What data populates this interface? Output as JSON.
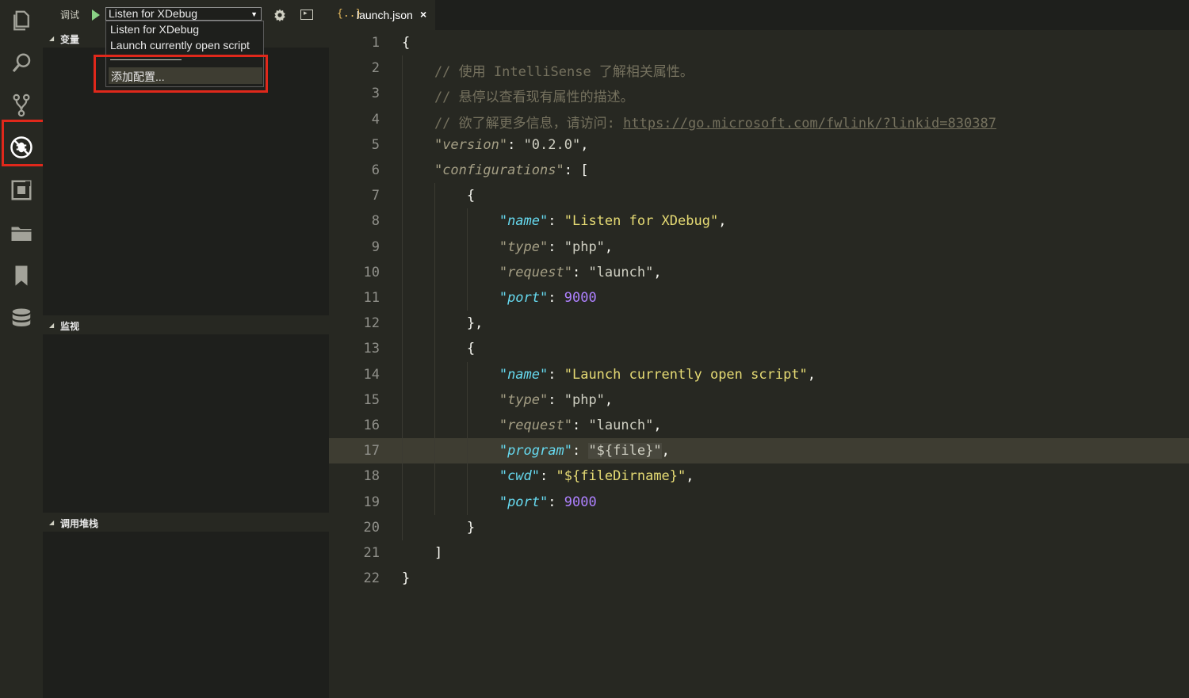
{
  "activity_bar": {
    "icons": [
      "explorer-icon",
      "search-icon",
      "source-control-icon",
      "debug-icon",
      "extensions-icon",
      "folder-icon",
      "bookmark-icon",
      "database-icon"
    ]
  },
  "debug": {
    "title": "调试",
    "selected_config": "Listen for XDebug",
    "options": [
      "Listen for XDebug",
      "Launch currently open script"
    ],
    "add_config": "添加配置..."
  },
  "sections": {
    "variables": "变量",
    "watch": "监视",
    "call_stack": "调用堆栈"
  },
  "editor": {
    "tab_icon": "{..}",
    "tab_label": "launch.json",
    "tab_close": "×",
    "current_line": 17,
    "lines": [
      [
        [
          "{",
          "punc"
        ]
      ],
      [
        [
          "    // 使用 IntelliSense 了解相关属性。",
          "com"
        ]
      ],
      [
        [
          "    // 悬停以查看现有属性的描述。",
          "com"
        ]
      ],
      [
        [
          "    // 欲了解更多信息，请访问: ",
          "com"
        ],
        [
          "https://go.microsoft.com/fwlink/?linkid=830387",
          "link"
        ]
      ],
      [
        [
          "    ",
          "punc"
        ],
        [
          "\"version\"",
          "keydim"
        ],
        [
          ": ",
          "punc"
        ],
        [
          "\"0.2.0\"",
          "strdim"
        ],
        [
          ",",
          "punc"
        ]
      ],
      [
        [
          "    ",
          "punc"
        ],
        [
          "\"configurations\"",
          "keydim"
        ],
        [
          ": [",
          "punc"
        ]
      ],
      [
        [
          "        {",
          "punc"
        ]
      ],
      [
        [
          "            ",
          "punc"
        ],
        [
          "\"name\"",
          "key"
        ],
        [
          ": ",
          "punc"
        ],
        [
          "\"Listen for XDebug\"",
          "str"
        ],
        [
          ",",
          "punc"
        ]
      ],
      [
        [
          "            ",
          "punc"
        ],
        [
          "\"type\"",
          "keydim"
        ],
        [
          ": ",
          "punc"
        ],
        [
          "\"php\"",
          "strdim"
        ],
        [
          ",",
          "punc"
        ]
      ],
      [
        [
          "            ",
          "punc"
        ],
        [
          "\"request\"",
          "keydim"
        ],
        [
          ": ",
          "punc"
        ],
        [
          "\"launch\"",
          "strdim"
        ],
        [
          ",",
          "punc"
        ]
      ],
      [
        [
          "            ",
          "punc"
        ],
        [
          "\"port\"",
          "key"
        ],
        [
          ": ",
          "punc"
        ],
        [
          "9000",
          "num"
        ]
      ],
      [
        [
          "        },",
          "punc"
        ]
      ],
      [
        [
          "        {",
          "punc"
        ]
      ],
      [
        [
          "            ",
          "punc"
        ],
        [
          "\"name\"",
          "key"
        ],
        [
          ": ",
          "punc"
        ],
        [
          "\"Launch currently open script\"",
          "str"
        ],
        [
          ",",
          "punc"
        ]
      ],
      [
        [
          "            ",
          "punc"
        ],
        [
          "\"type\"",
          "keydim"
        ],
        [
          ": ",
          "punc"
        ],
        [
          "\"php\"",
          "strdim"
        ],
        [
          ",",
          "punc"
        ]
      ],
      [
        [
          "            ",
          "punc"
        ],
        [
          "\"request\"",
          "keydim"
        ],
        [
          ": ",
          "punc"
        ],
        [
          "\"launch\"",
          "strdim"
        ],
        [
          ",",
          "punc"
        ]
      ],
      [
        [
          "            ",
          "punc"
        ],
        [
          "\"program\"",
          "key"
        ],
        [
          ": ",
          "punc"
        ],
        [
          "\"${file}\"",
          "strsel"
        ],
        [
          ",",
          "punc"
        ]
      ],
      [
        [
          "            ",
          "punc"
        ],
        [
          "\"cwd\"",
          "key"
        ],
        [
          ": ",
          "punc"
        ],
        [
          "\"${fileDirname}\"",
          "str"
        ],
        [
          ",",
          "punc"
        ]
      ],
      [
        [
          "            ",
          "punc"
        ],
        [
          "\"port\"",
          "key"
        ],
        [
          ": ",
          "punc"
        ],
        [
          "9000",
          "num"
        ]
      ],
      [
        [
          "        }",
          "punc"
        ]
      ],
      [
        [
          "    ]",
          "punc"
        ]
      ],
      [
        [
          "}",
          "punc"
        ]
      ]
    ]
  }
}
